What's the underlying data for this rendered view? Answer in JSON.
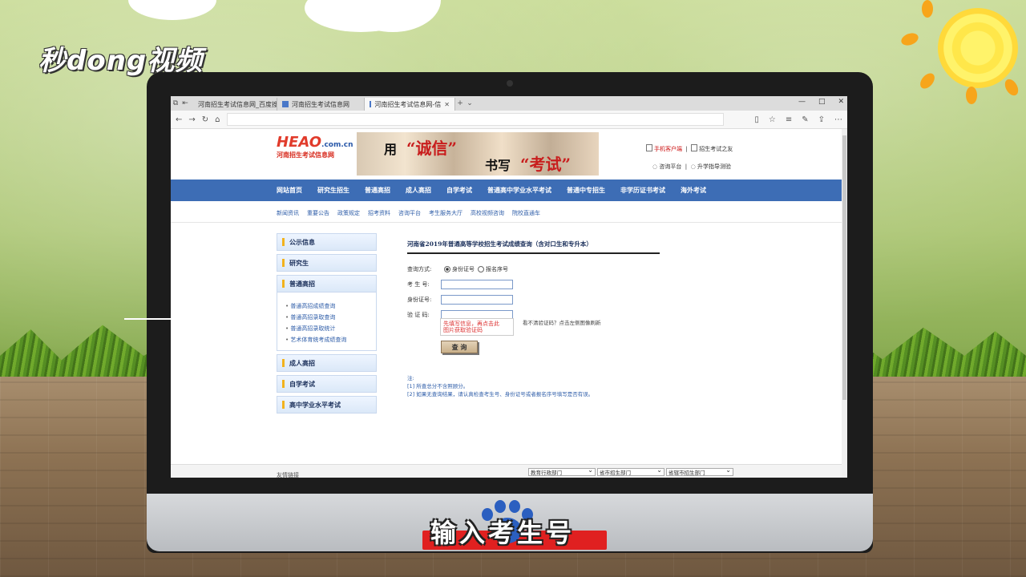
{
  "overlay": {
    "brand_logo": "秒dong视频",
    "caption": "输入考生号",
    "colors": {
      "caption_outline": "#222222",
      "paw": "#2b5fc0",
      "sun": "#ffe74a"
    }
  },
  "browser": {
    "tabs": [
      {
        "title": "河南招生考试信息网_百度搜",
        "active": false
      },
      {
        "title": "河南招生考试信息网",
        "active": false
      },
      {
        "title": "河南招生考试信息网-信",
        "active": true
      }
    ],
    "new_tab_label": "+",
    "window_controls": [
      "—",
      "□",
      "✕"
    ],
    "nav_icons": [
      "back-icon",
      "forward-icon",
      "refresh-icon",
      "home-icon"
    ],
    "toolbar_icons": [
      "reading-view-icon",
      "favorite-icon",
      "favorites-hub-icon",
      "pen-icon",
      "share-icon",
      "more-icon"
    ]
  },
  "site": {
    "logo_mark": "HEAO",
    "logo_domain": ".com.cn",
    "logo_name": "河南招生考试信息网",
    "banner": {
      "t1": "用",
      "t2": "“诚信”",
      "t3": "书写",
      "t4": "“考试”"
    },
    "header_links": {
      "mobile": "手机客户端",
      "exam_home": "招生考试之友",
      "consult": "咨询平台",
      "guide": "升学指导测验"
    },
    "nav": [
      "网站首页",
      "研究生招生",
      "普通高招",
      "成人高招",
      "自学考试",
      "普通高中学业水平考试",
      "普通中专招生",
      "非学历证书考试",
      "海外考试"
    ],
    "subnav": [
      "新闻资讯",
      "重要公告",
      "政策规定",
      "招考资料",
      "咨询平台",
      "考生服务大厅",
      "高校视频咨询",
      "院校直通车"
    ],
    "sidebar": {
      "sections": [
        "公示信息",
        "研究生",
        "普通高招",
        "成人高招",
        "自学考试",
        "高中学业水平考试"
      ],
      "sub_items": [
        "普通高招成绩查询",
        "普通高招录取查询",
        "普通高招录取统计",
        "艺术体育统考成绩查询"
      ]
    },
    "form": {
      "title": "河南省2019年普通高等学校招生考试成绩查询（含对口生和专升本）",
      "query_mode_label": "查询方式:",
      "radio_id": "身份证号",
      "radio_reg": "报名序号",
      "exam_no_label": "考 生 号:",
      "id_label": "身份证号:",
      "captcha_label": "验 证 码:",
      "tip": "先填写信息，再点击此 ",
      "tip2": "图片获取验证码",
      "captcha_hint": "看不清验证码？点击左侧图像刷新",
      "submit": "查 询",
      "notes_title": "注:",
      "notes": [
        "[1] 所查总分不含照顾分。",
        "[2] 如果无查询结果，请认真检查考生号、身份证号或者报名序号填写是否有误。"
      ]
    },
    "footer": {
      "link": "友情链接",
      "selects": [
        "教育行政部门",
        "省市招生部门",
        "省辖市招生部门"
      ]
    }
  }
}
